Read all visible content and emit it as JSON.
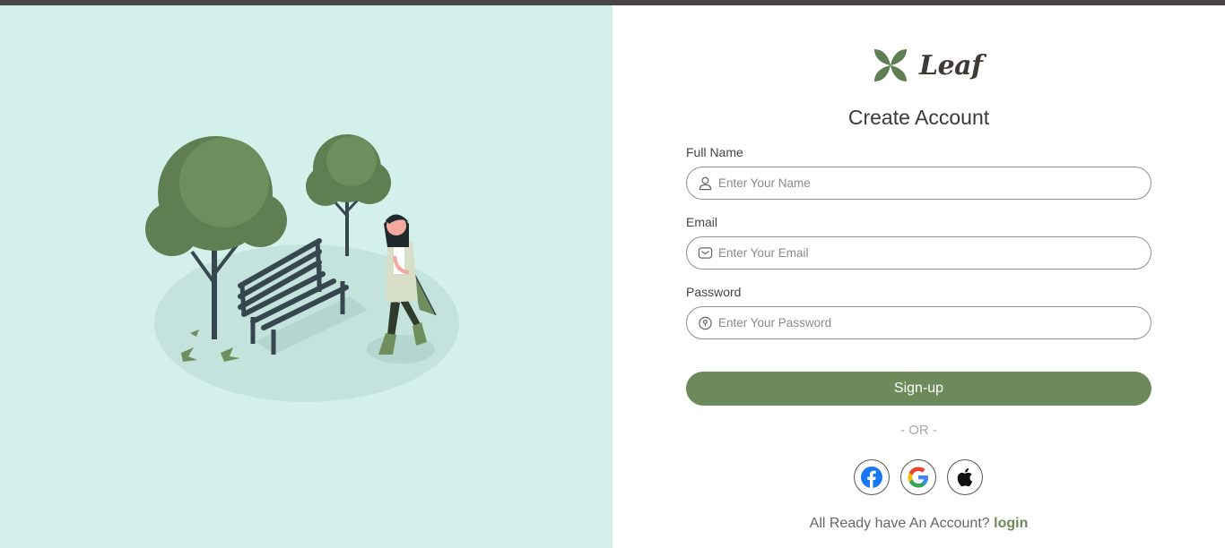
{
  "brand": {
    "name": "Leaf",
    "accent_color": "#6d8a5a",
    "illustration_bg": "#d3f1ea",
    "logo_icon": "four-leaf-icon"
  },
  "form": {
    "title": "Create Account",
    "fields": [
      {
        "label": "Full Name",
        "placeholder": "Enter Your Name",
        "icon": "user-icon"
      },
      {
        "label": "Email",
        "placeholder": "Enter Your Email",
        "icon": "envelope-icon"
      },
      {
        "label": "Password",
        "placeholder": "Enter Your Password",
        "icon": "key-icon"
      }
    ],
    "submit_label": "Sign-up",
    "divider": "- OR -",
    "socials": [
      {
        "icon": "facebook-icon",
        "color": "#1877f2"
      },
      {
        "icon": "google-icon"
      },
      {
        "icon": "apple-icon",
        "color": "#111111"
      }
    ],
    "footer": {
      "prompt": "All Ready have An Account?",
      "link": "login"
    }
  }
}
